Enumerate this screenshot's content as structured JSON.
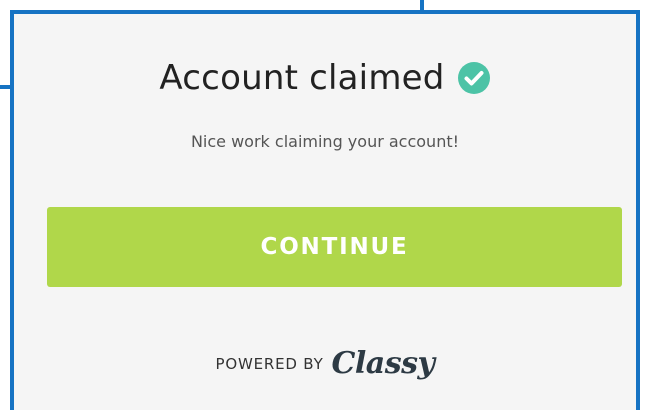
{
  "modal": {
    "title": "Account claimed",
    "subtitle": "Nice work claiming your account!",
    "continue_label": "CONTINUE",
    "powered_by": "POWERED BY",
    "brand": "Classy"
  },
  "icons": {
    "title_icon": "check-circle-icon"
  },
  "colors": {
    "modal_border": "#1673c3",
    "check_icon": "#4cc3a6",
    "button": "#b0d74a",
    "button_text": "#ffffff",
    "modal_background": "#f5f5f5"
  }
}
